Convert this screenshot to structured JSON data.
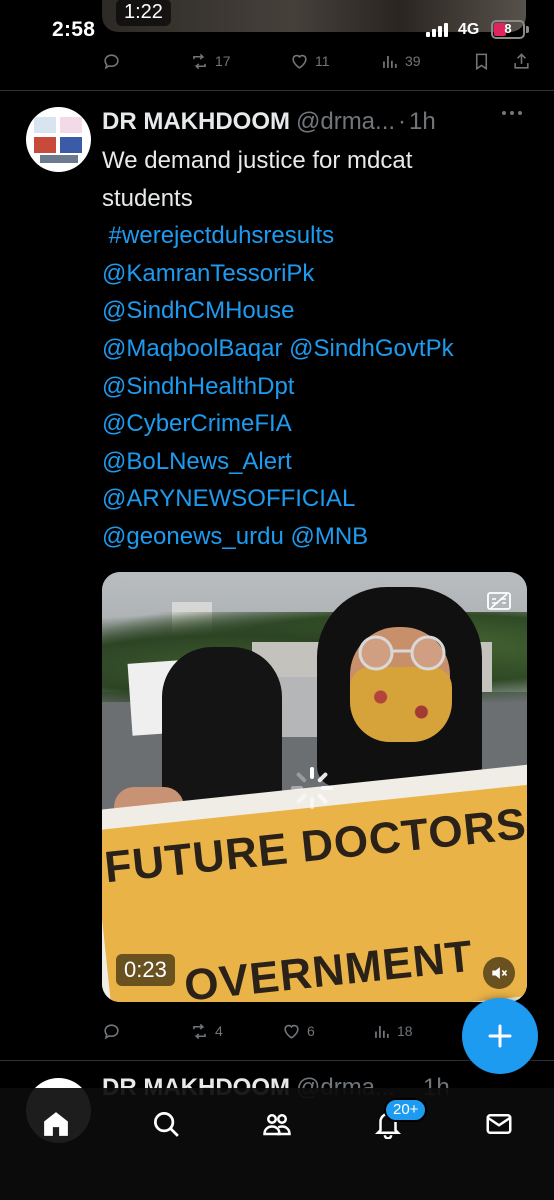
{
  "status_bar": {
    "time": "2:58",
    "network": "4G",
    "battery": "8"
  },
  "prev_tweet": {
    "media_duration": "1:22",
    "retweets": "17",
    "likes": "11",
    "views": "39"
  },
  "tweet": {
    "author_name": "DR MAKHDOOM",
    "handle": "@drma...",
    "separator": "·",
    "time": "1h",
    "text_lines": [
      {
        "text": "We demand justice for mdcat",
        "link": false
      },
      {
        "text": "students",
        "link": false
      },
      {
        "text": " #werejectduhsresults",
        "link": true
      },
      {
        "text": "@KamranTessoriPk",
        "link": true
      },
      {
        "text": "@SindhCMHouse",
        "link": true
      },
      {
        "text": "@MaqboolBaqar @SindhGovtPk",
        "link": true
      },
      {
        "text": "@SindhHealthDpt",
        "link": true
      },
      {
        "text": "@CyberCrimeFIA",
        "link": true
      },
      {
        "text": "@BoLNews_Alert",
        "link": true
      },
      {
        "text": "@ARYNEWSOFFICIAL",
        "link": true
      },
      {
        "text": "@geonews_urdu @MNB",
        "link": true
      }
    ],
    "video": {
      "banner_line1": "FUTURE DOCTORS",
      "banner_line2": "OVERNMENT",
      "duration": "0:23"
    },
    "replies": "",
    "retweets": "4",
    "likes": "6",
    "views": "18"
  },
  "next_tweet": {
    "author_name": "DR MAKHDOOM",
    "handle": "@drma...",
    "time": "1h"
  },
  "bottom_nav": {
    "notifications_badge": "20+"
  },
  "colors": {
    "accent": "#1d9bf0",
    "muted": "#71767b",
    "text": "#e7e9ea",
    "background": "#000000"
  },
  "icons": [
    "reply-icon",
    "retweet-icon",
    "like-icon",
    "views-icon",
    "bookmark-icon",
    "share-icon",
    "more-icon",
    "captions-icon",
    "mute-icon",
    "compose-icon",
    "home-icon",
    "search-icon",
    "communities-icon",
    "notifications-icon",
    "messages-icon"
  ]
}
